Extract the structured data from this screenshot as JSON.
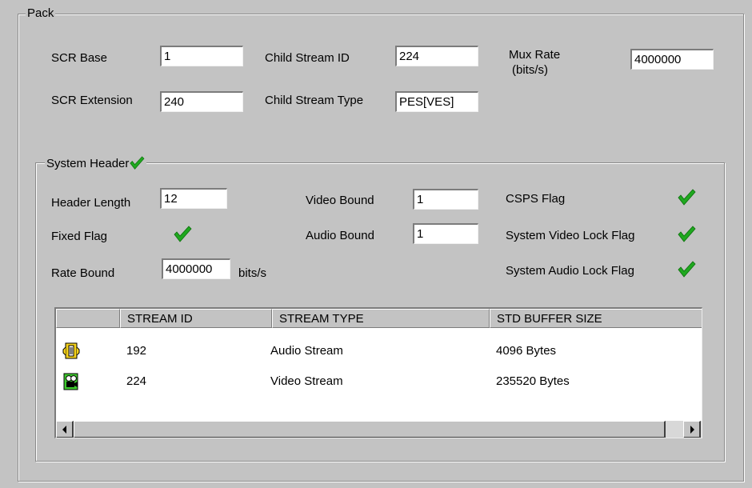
{
  "pack": {
    "legend": "Pack",
    "scr_base": {
      "label": "SCR Base",
      "value": "1"
    },
    "scr_extension": {
      "label": "SCR Extension",
      "value": "240"
    },
    "child_stream_id": {
      "label": "Child Stream ID",
      "value": "224"
    },
    "child_stream_type": {
      "label": "Child Stream Type",
      "value": "PES[VES]"
    },
    "mux_rate": {
      "label": "Mux Rate",
      "unit_label": "(bits/s)",
      "value": "4000000"
    }
  },
  "system_header": {
    "legend": "System Header",
    "checked": true,
    "header_length": {
      "label": "Header Length",
      "value": "12"
    },
    "fixed_flag": {
      "label": "Fixed Flag",
      "checked": true
    },
    "rate_bound": {
      "label": "Rate Bound",
      "value": "4000000",
      "unit": "bits/s"
    },
    "video_bound": {
      "label": "Video Bound",
      "value": "1"
    },
    "audio_bound": {
      "label": "Audio Bound",
      "value": "1"
    },
    "csps_flag": {
      "label": "CSPS Flag",
      "checked": true
    },
    "system_video_lock_flag": {
      "label": "System Video Lock Flag",
      "checked": true
    },
    "system_audio_lock_flag": {
      "label": "System Audio Lock Flag",
      "checked": true
    }
  },
  "stream_table": {
    "columns": [
      "STREAM ID",
      "STREAM TYPE",
      "STD BUFFER SIZE"
    ],
    "rows": [
      {
        "icon": "audio-stream-icon",
        "stream_id": "192",
        "stream_type": "Audio Stream",
        "buffer_size": "4096 Bytes"
      },
      {
        "icon": "video-stream-icon",
        "stream_id": "224",
        "stream_type": "Video Stream",
        "buffer_size": "235520 Bytes"
      }
    ]
  },
  "colors": {
    "background": "#c3c3c3",
    "check_green": "#1fa81f",
    "field_background": "#ffffff"
  }
}
